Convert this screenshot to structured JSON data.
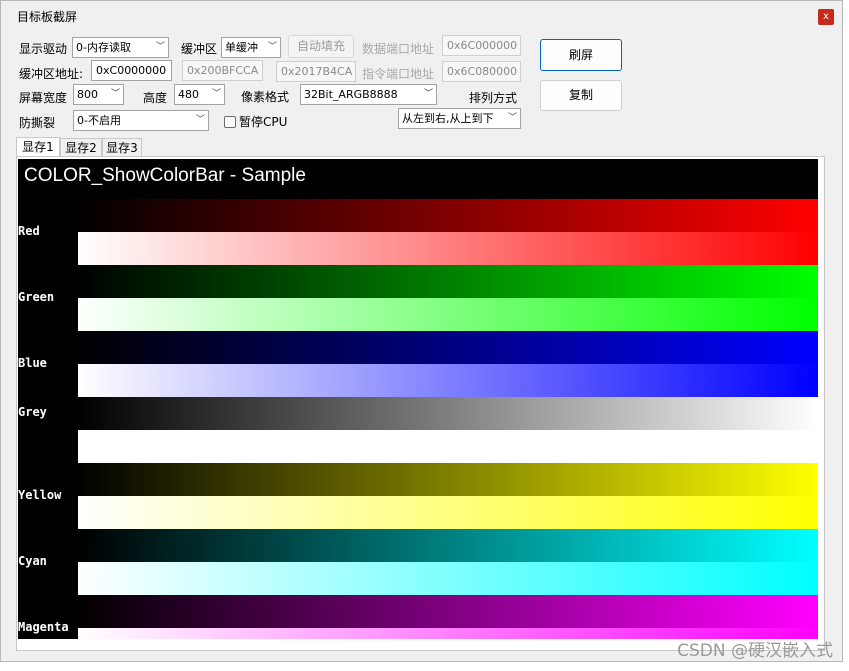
{
  "window": {
    "title": "目标板截屏",
    "close_label": "x"
  },
  "row1": {
    "driver_label": "显示驱动",
    "driver_value": "0-内存读取",
    "buffer_label": "缓冲区",
    "buffer_value": "单缓冲",
    "autofill_label": "自动填充",
    "data_port_label": "数据端口地址",
    "data_port_value": "0x6C000000",
    "refresh_label": "刷屏"
  },
  "row2": {
    "buffer_addr_label": "缓冲区地址:",
    "buffer_addr_value": "0xC0000000",
    "addr2_value": "0x200BFCCA",
    "addr3_value": "0x2017B4CA",
    "cmd_port_label": "指令端口地址",
    "cmd_port_value": "0x6C080000",
    "copy_label": "复制"
  },
  "row3": {
    "width_label": "屏幕宽度",
    "width_value": "800",
    "height_label": "高度",
    "height_value": "480",
    "pixel_format_label": "像素格式",
    "pixel_format_value": "32Bit_ARGB8888",
    "order_label": "排列方式"
  },
  "row4": {
    "tear_label": "防撕裂",
    "tear_value": "0-不启用",
    "pause_cpu_label": "暂停CPU",
    "pause_cpu_checked": false,
    "order_value": "从左到右,从上到下"
  },
  "tabs": [
    "显存1",
    "显存2",
    "显存3"
  ],
  "active_tab": 0,
  "screen": {
    "heading": "COLOR_ShowColorBar - Sample",
    "bars": [
      {
        "label": "Red",
        "color": "#ff0000"
      },
      {
        "label": "Green",
        "color": "#00ff00"
      },
      {
        "label": "Blue",
        "color": "#0000ff"
      },
      {
        "label": "Grey",
        "color": "#ffffff"
      },
      {
        "label": "Yellow",
        "color": "#ffff00"
      },
      {
        "label": "Cyan",
        "color": "#00ffff"
      },
      {
        "label": "Magenta",
        "color": "#ff00ff"
      }
    ]
  },
  "watermark": "CSDN @硬汉嵌入式"
}
